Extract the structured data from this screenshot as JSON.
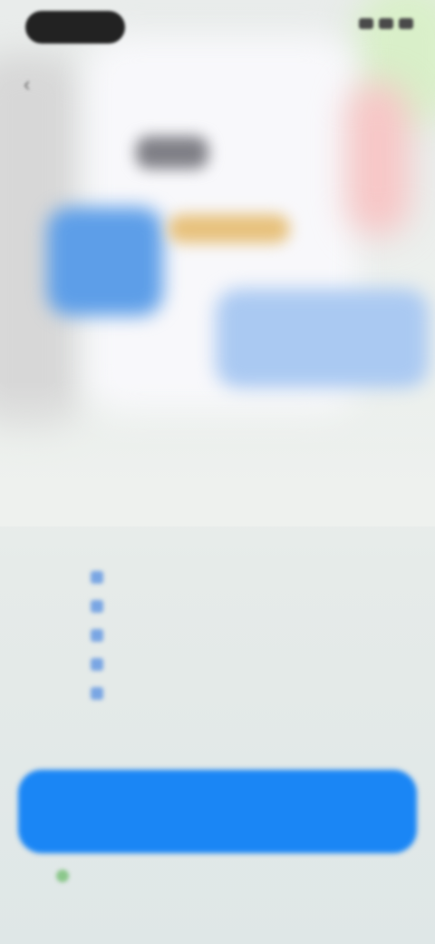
{
  "status_bar": {
    "time": "",
    "icons": [
      "signal-icon",
      "wifi-icon",
      "battery-icon"
    ]
  },
  "headline": {
    "before": "",
    "accent": "",
    "after": ""
  },
  "features": [
    {
      "label": ""
    },
    {
      "label": ""
    },
    {
      "label": ""
    },
    {
      "label": ""
    },
    {
      "label": ""
    }
  ],
  "fine_print": "",
  "cta": {
    "label": ""
  },
  "bottom_link": {
    "label": ""
  },
  "colors": {
    "accent": "#1a86f5",
    "headline_accent": "#3d8be8",
    "background": "#eceeed"
  }
}
